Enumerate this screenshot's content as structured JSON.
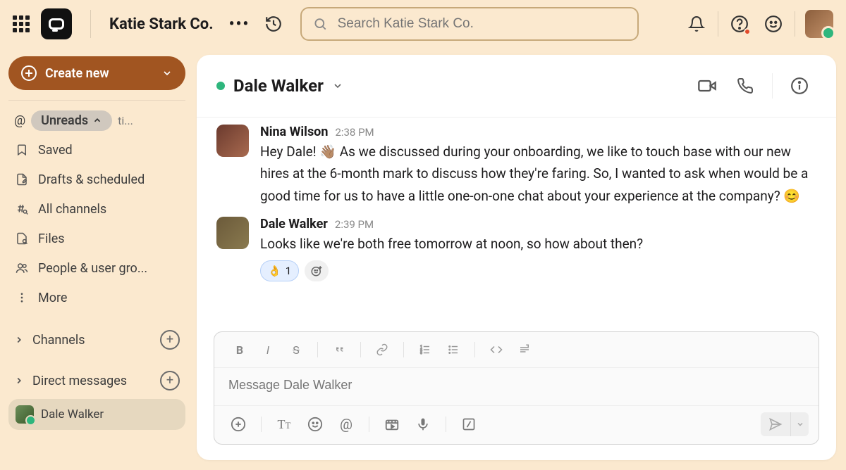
{
  "workspace": {
    "name": "Katie Stark Co.",
    "search_placeholder": "Search Katie Stark Co."
  },
  "sidebar": {
    "create_label": "Create new",
    "unreads_label": "Unreads",
    "mentions_tail": "ti...",
    "nav": [
      {
        "label": "Saved"
      },
      {
        "label": "Drafts & scheduled"
      },
      {
        "label": "All channels"
      },
      {
        "label": "Files"
      },
      {
        "label": "People & user gro..."
      },
      {
        "label": "More"
      }
    ],
    "channels_label": "Channels",
    "dms_label": "Direct messages",
    "active_dm": "Dale Walker"
  },
  "chat": {
    "title": "Dale Walker",
    "messages": [
      {
        "author": "Nina Wilson",
        "time": "2:38 PM",
        "text": "Hey Dale! 👋🏽 As we discussed during your onboarding, we like to touch base with our new hires at the 6-month mark to discuss how they're faring. So, I wanted to ask when would be a good time for us to have a little one-on-one chat about your experience at the company? 😊"
      },
      {
        "author": "Dale Walker",
        "time": "2:39 PM",
        "text": "Looks like we're both free tomorrow at noon, so how about then?",
        "reaction_emoji": "👌",
        "reaction_count": "1"
      }
    ],
    "composer_placeholder": "Message Dale Walker"
  }
}
